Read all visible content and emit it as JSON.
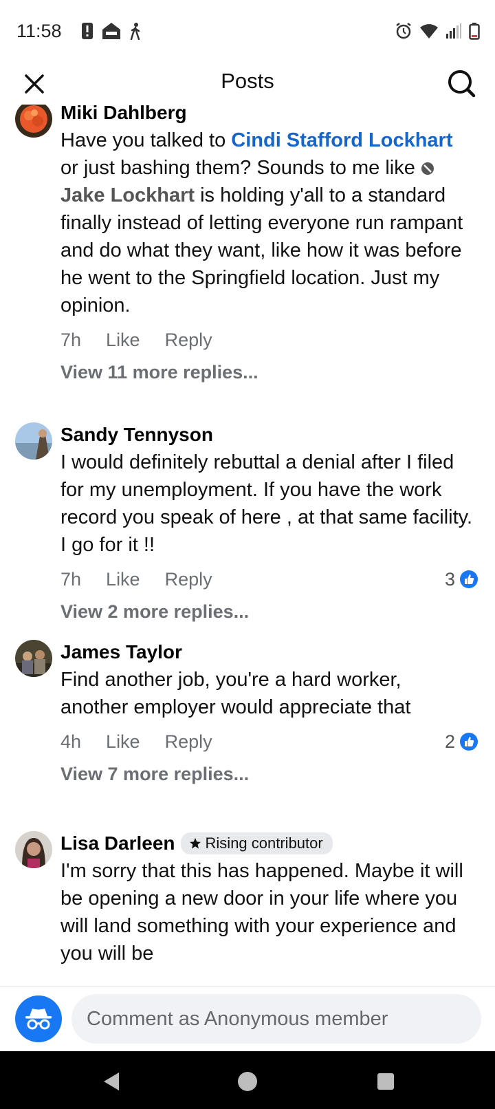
{
  "status_bar": {
    "time": "11:58",
    "left_icons": [
      "alert-icon",
      "roku-icon",
      "walk-icon"
    ],
    "right_icons": [
      "alarm-icon",
      "wifi-icon",
      "signal-icon",
      "battery-icon"
    ]
  },
  "header": {
    "title": "Posts",
    "close_icon": "close-icon",
    "search_icon": "search-icon"
  },
  "comments": [
    {
      "author": "Miki Dahlberg",
      "text_parts": {
        "p1": "Have you talked to ",
        "mention1": "Cindi Stafford Lockhart",
        "p2": " or just bashing them? Sounds to me like ",
        "mention2": "Jake Lockhart",
        "p3": " is holding y'all to a standard finally instead of letting everyone run rampant and do what they want, like how it was before he went to the Springfield location. Just my opinion."
      },
      "time": "7h",
      "like": "Like",
      "reply": "Reply",
      "more_replies": "View 11 more replies..."
    },
    {
      "author": "Sandy Tennyson",
      "text": "I would definitely rebuttal a denial after I filed for my unemployment. If you have the work record you speak of here , at that same facility. I go for it !!",
      "time": "7h",
      "like": "Like",
      "reply": "Reply",
      "reaction_count": "3",
      "more_replies": "View 2 more replies..."
    },
    {
      "author": "James Taylor",
      "text": "Find another job, you're a hard worker, another employer would appreciate that",
      "time": "4h",
      "like": "Like",
      "reply": "Reply",
      "reaction_count": "2",
      "more_replies": "View 7 more replies..."
    },
    {
      "author": "Lisa Darleen",
      "badge": "Rising contributor",
      "text": "I'm sorry that this has happened. Maybe it will be opening a new door in your life where you will land something with your experience and you will be"
    }
  ],
  "composer": {
    "placeholder": "Comment as Anonymous member"
  },
  "colors": {
    "accent": "#1877f2",
    "mention": "#1666c9",
    "secondary_text": "#6b6f74"
  }
}
